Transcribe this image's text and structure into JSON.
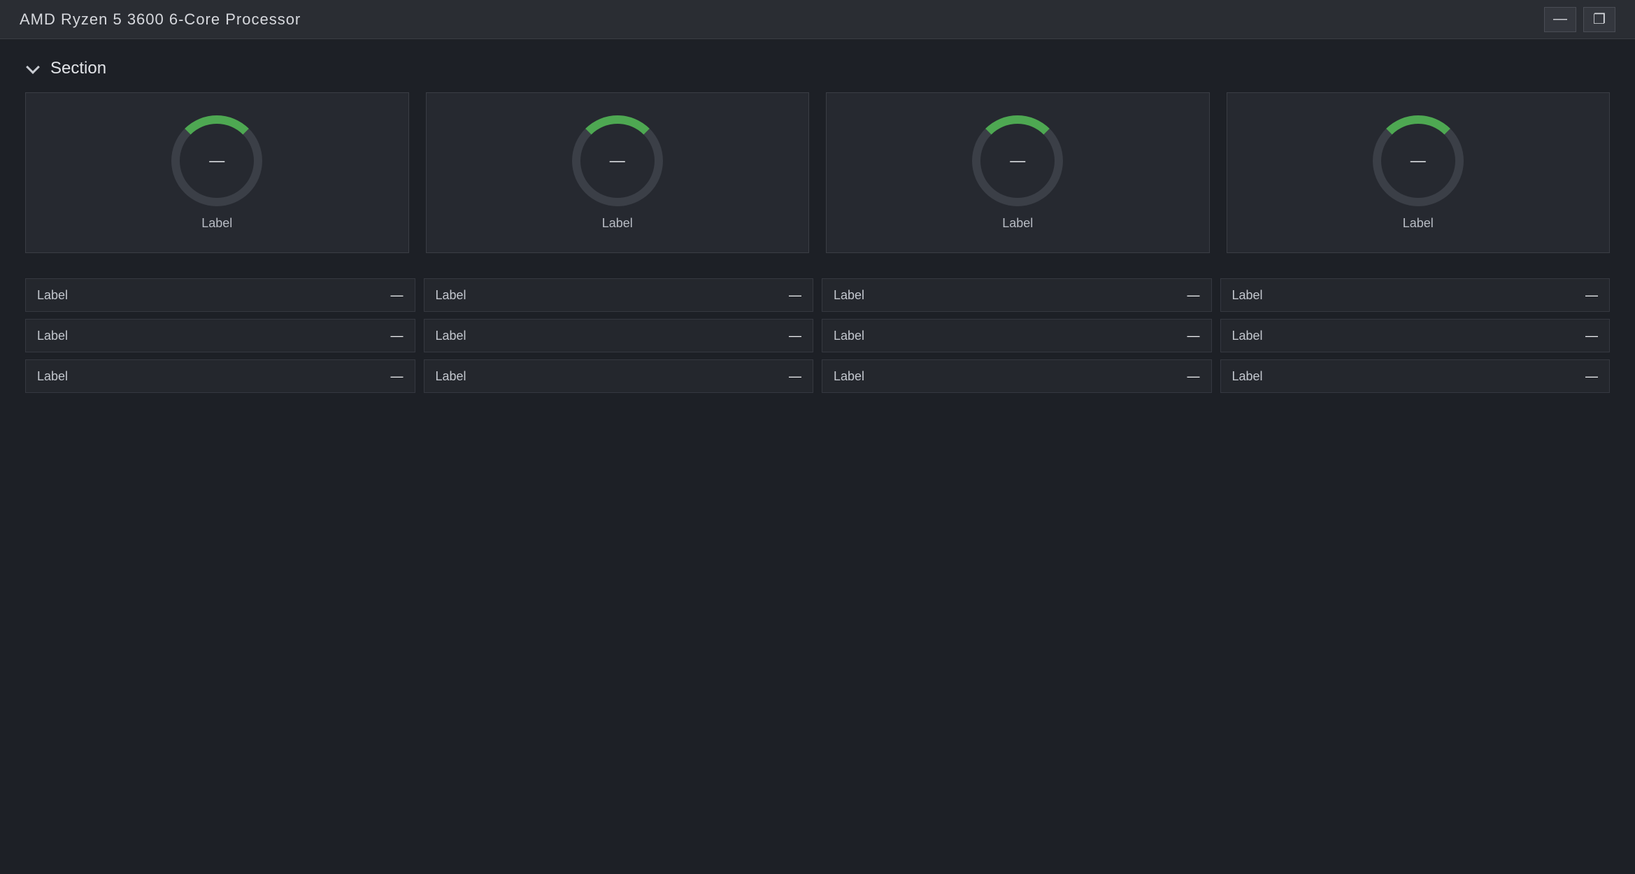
{
  "window": {
    "title": "AMD Ryzen 5 3600 6-Core Processor"
  },
  "section": {
    "title": "Section"
  },
  "gauges": [
    {
      "value": "—",
      "label": "Label"
    },
    {
      "value": "—",
      "label": "Label"
    },
    {
      "value": "—",
      "label": "Label"
    },
    {
      "value": "—",
      "label": "Label"
    }
  ],
  "rows": [
    [
      {
        "label": "Label",
        "value": "—"
      },
      {
        "label": "Label",
        "value": "—"
      },
      {
        "label": "Label",
        "value": "—"
      },
      {
        "label": "Label",
        "value": "—"
      }
    ],
    [
      {
        "label": "Label",
        "value": "—"
      },
      {
        "label": "Label",
        "value": "—"
      },
      {
        "label": "Label",
        "value": "—"
      },
      {
        "label": "Label",
        "value": "—"
      }
    ],
    [
      {
        "label": "Label",
        "value": "—"
      },
      {
        "label": "Label",
        "value": "—"
      },
      {
        "label": "Label",
        "value": "—"
      },
      {
        "label": "Label",
        "value": "—"
      }
    ]
  ]
}
